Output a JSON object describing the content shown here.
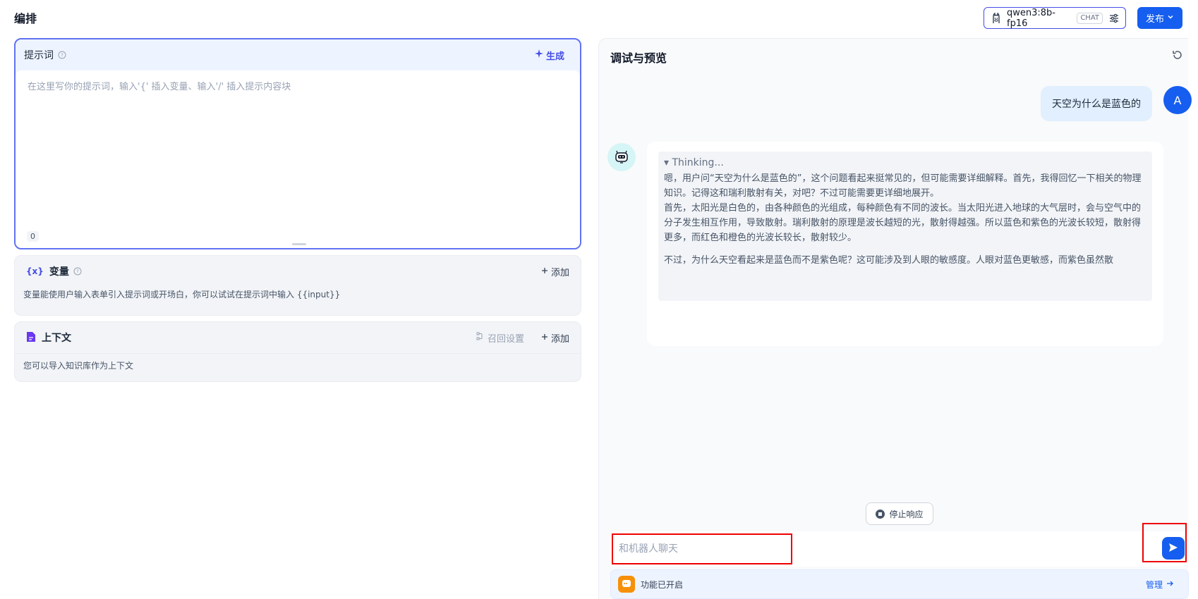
{
  "header": {
    "title": "编排",
    "model_name": "qwen3:8b-fp16",
    "model_badge": "CHAT",
    "publish_label": "发布"
  },
  "prompt": {
    "title": "提示词",
    "generate_label": "生成",
    "placeholder": "在这里写你的提示词，输入'{' 插入变量、输入'/' 插入提示内容块",
    "char_count": "0"
  },
  "variables": {
    "icon_text": "{x}",
    "title": "变量",
    "add_label": "添加",
    "description": "变量能使用户输入表单引入提示词或开场白，你可以试试在提示词中输入 {{input}}"
  },
  "context": {
    "title": "上下文",
    "recall_label": "召回设置",
    "add_label": "添加",
    "description": "您可以导入知识库作为上下文"
  },
  "debug": {
    "title": "调试与预览",
    "user_avatar_letter": "A",
    "user_message": "天空为什么是蓝色的",
    "thinking_label": "▾ Thinking...",
    "thinking_paragraphs": [
      "嗯，用户问“天空为什么是蓝色的”，这个问题看起来挺常见的，但可能需要详细解释。首先，我得回忆一下相关的物理知识。记得这和瑞利散射有关，对吧？不过可能需要更详细地展开。",
      "首先，太阳光是白色的，由各种颜色的光组成，每种颜色有不同的波长。当太阳光进入地球的大气层时，会与空气中的分子发生相互作用，导致散射。瑞利散射的原理是波长越短的光，散射得越强。所以蓝色和紫色的光波长较短，散射得更多，而红色和橙色的光波长较长，散射较少。",
      "不过，为什么天空看起来是蓝色而不是紫色呢？这可能涉及到人眼的敏感度。人眼对蓝色更敏感，而紫色虽然散"
    ],
    "stop_label": "停止响应",
    "chat_placeholder": "和机器人聊天",
    "feature_label": "功能已开启",
    "manage_label": "管理"
  },
  "colors": {
    "accent": "#155eef",
    "indigo": "#444ce7",
    "highlight_border": "#ee0000"
  }
}
